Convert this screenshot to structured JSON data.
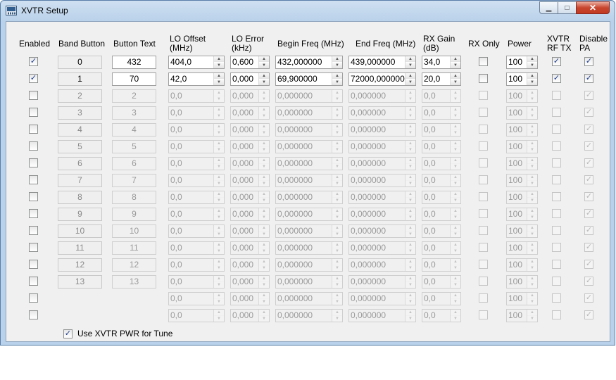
{
  "window": {
    "title": "XVTR Setup",
    "min_glyph": "▁",
    "max_glyph": "□",
    "close_glyph": "✕"
  },
  "headers": {
    "enabled": "Enabled",
    "band_button": "Band Button",
    "button_text": "Button Text",
    "lo_offset": [
      "LO Offset",
      "(MHz)"
    ],
    "lo_error": [
      "LO Error",
      "(kHz)"
    ],
    "begin_freq": "Begin Freq (MHz)",
    "end_freq": "End Freq (MHz)",
    "rx_gain": [
      "RX Gain",
      "(dB)"
    ],
    "rx_only": "RX Only",
    "power": "Power",
    "xvtr_rf_tx": [
      "XVTR",
      "RF TX"
    ],
    "disable_pa": [
      "Disable",
      "PA"
    ]
  },
  "check_glyph": "✓",
  "rows": [
    {
      "enabled": true,
      "active": true,
      "band": "0",
      "text": "432",
      "lo_offset": "404,0",
      "lo_error": "0,600",
      "begin": "432,000000",
      "end": "439,000000",
      "gain": "34,0",
      "rx_only": false,
      "power": "100",
      "rf_tx": true,
      "disable_pa": true
    },
    {
      "enabled": true,
      "active": true,
      "band": "1",
      "text": "70",
      "lo_offset": "42,0",
      "lo_error": "0,000",
      "begin": "69,900000",
      "end": "72000,000000",
      "gain": "20,0",
      "rx_only": false,
      "power": "100",
      "rf_tx": true,
      "disable_pa": true
    },
    {
      "enabled": false,
      "active": false,
      "band": "2",
      "text": "2",
      "lo_offset": "0,0",
      "lo_error": "0,000",
      "begin": "0,000000",
      "end": "0,000000",
      "gain": "0,0",
      "rx_only": false,
      "power": "100",
      "rf_tx": false,
      "disable_pa": true
    },
    {
      "enabled": false,
      "active": false,
      "band": "3",
      "text": "3",
      "lo_offset": "0,0",
      "lo_error": "0,000",
      "begin": "0,000000",
      "end": "0,000000",
      "gain": "0,0",
      "rx_only": false,
      "power": "100",
      "rf_tx": false,
      "disable_pa": true
    },
    {
      "enabled": false,
      "active": false,
      "band": "4",
      "text": "4",
      "lo_offset": "0,0",
      "lo_error": "0,000",
      "begin": "0,000000",
      "end": "0,000000",
      "gain": "0,0",
      "rx_only": false,
      "power": "100",
      "rf_tx": false,
      "disable_pa": true
    },
    {
      "enabled": false,
      "active": false,
      "band": "5",
      "text": "5",
      "lo_offset": "0,0",
      "lo_error": "0,000",
      "begin": "0,000000",
      "end": "0,000000",
      "gain": "0,0",
      "rx_only": false,
      "power": "100",
      "rf_tx": false,
      "disable_pa": true
    },
    {
      "enabled": false,
      "active": false,
      "band": "6",
      "text": "6",
      "lo_offset": "0,0",
      "lo_error": "0,000",
      "begin": "0,000000",
      "end": "0,000000",
      "gain": "0,0",
      "rx_only": false,
      "power": "100",
      "rf_tx": false,
      "disable_pa": true
    },
    {
      "enabled": false,
      "active": false,
      "band": "7",
      "text": "7",
      "lo_offset": "0,0",
      "lo_error": "0,000",
      "begin": "0,000000",
      "end": "0,000000",
      "gain": "0,0",
      "rx_only": false,
      "power": "100",
      "rf_tx": false,
      "disable_pa": true
    },
    {
      "enabled": false,
      "active": false,
      "band": "8",
      "text": "8",
      "lo_offset": "0,0",
      "lo_error": "0,000",
      "begin": "0,000000",
      "end": "0,000000",
      "gain": "0,0",
      "rx_only": false,
      "power": "100",
      "rf_tx": false,
      "disable_pa": true
    },
    {
      "enabled": false,
      "active": false,
      "band": "9",
      "text": "9",
      "lo_offset": "0,0",
      "lo_error": "0,000",
      "begin": "0,000000",
      "end": "0,000000",
      "gain": "0,0",
      "rx_only": false,
      "power": "100",
      "rf_tx": false,
      "disable_pa": true
    },
    {
      "enabled": false,
      "active": false,
      "band": "10",
      "text": "10",
      "lo_offset": "0,0",
      "lo_error": "0,000",
      "begin": "0,000000",
      "end": "0,000000",
      "gain": "0,0",
      "rx_only": false,
      "power": "100",
      "rf_tx": false,
      "disable_pa": true
    },
    {
      "enabled": false,
      "active": false,
      "band": "11",
      "text": "11",
      "lo_offset": "0,0",
      "lo_error": "0,000",
      "begin": "0,000000",
      "end": "0,000000",
      "gain": "0,0",
      "rx_only": false,
      "power": "100",
      "rf_tx": false,
      "disable_pa": true
    },
    {
      "enabled": false,
      "active": false,
      "band": "12",
      "text": "12",
      "lo_offset": "0,0",
      "lo_error": "0,000",
      "begin": "0,000000",
      "end": "0,000000",
      "gain": "0,0",
      "rx_only": false,
      "power": "100",
      "rf_tx": false,
      "disable_pa": true
    },
    {
      "enabled": false,
      "active": false,
      "band": "13",
      "text": "13",
      "lo_offset": "0,0",
      "lo_error": "0,000",
      "begin": "0,000000",
      "end": "0,000000",
      "gain": "0,0",
      "rx_only": false,
      "power": "100",
      "rf_tx": false,
      "disable_pa": true
    },
    {
      "enabled": false,
      "active": false,
      "band": null,
      "text": null,
      "lo_offset": "0,0",
      "lo_error": "0,000",
      "begin": "0,000000",
      "end": "0,000000",
      "gain": "0,0",
      "rx_only": false,
      "power": "100",
      "rf_tx": false,
      "disable_pa": true
    },
    {
      "enabled": false,
      "active": false,
      "band": null,
      "text": null,
      "lo_offset": "0,0",
      "lo_error": "0,000",
      "begin": "0,000000",
      "end": "0,000000",
      "gain": "0,0",
      "rx_only": false,
      "power": "100",
      "rf_tx": false,
      "disable_pa": true
    }
  ],
  "tune": {
    "label": "Use XVTR PWR for Tune",
    "checked": true
  }
}
